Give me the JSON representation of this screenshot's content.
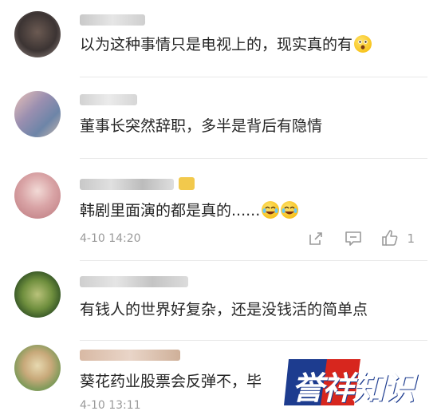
{
  "comments": [
    {
      "username": "",
      "text": "以为这种事情只是电视上的，现实真的有",
      "emoji": "astonished-face"
    },
    {
      "username": "",
      "text": "董事长突然辞职，多半是背后有隐情"
    },
    {
      "username": "",
      "text": "韩剧里面演的都是真的......",
      "emoji": "laughing-crying-face",
      "time": "4-10 14:20",
      "like_count": "1"
    },
    {
      "username": "",
      "text": "有钱人的世界好复杂，还是没钱活的简单点"
    },
    {
      "username": "",
      "text": "葵花药业股票会反弹不，毕",
      "time": "4-10 13:11"
    }
  ],
  "watermark": {
    "text": "誉祥知识"
  },
  "colors": {
    "accent_blue": "#1d3c8f",
    "brand_red": "#d7261e",
    "muted": "#9a9a9a"
  }
}
